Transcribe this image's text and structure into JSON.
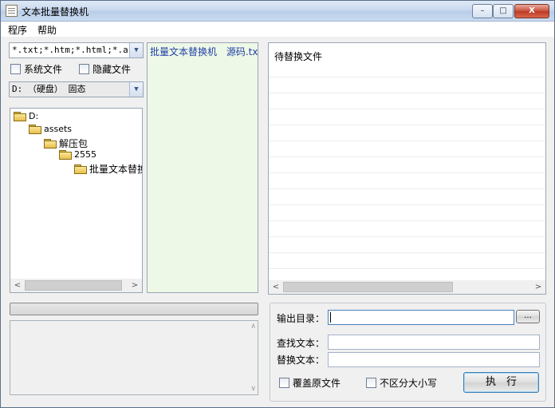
{
  "window": {
    "title": "文本批量替换机"
  },
  "titlebar": {
    "min": "–",
    "max": "□",
    "close": "X"
  },
  "menu": [
    {
      "label": "程序"
    },
    {
      "label": "帮助"
    }
  ],
  "filter": {
    "value": "*.txt;*.htm;*.html;*.asp"
  },
  "options": {
    "system_files": "系统文件",
    "hidden_files": "隐藏文件"
  },
  "drive": {
    "value": "D: （硬盘） 固态"
  },
  "tree": [
    {
      "label": "D:",
      "level": 0
    },
    {
      "label": "assets",
      "level": 1
    },
    {
      "label": "解压包",
      "level": 2
    },
    {
      "label": "2555",
      "level": 3
    },
    {
      "label": "批量文本替换",
      "level": 4
    }
  ],
  "file_list": {
    "items": [
      "批量文本替换机",
      "源码.txt"
    ]
  },
  "preview": {
    "header": "待替换文件"
  },
  "output": {
    "dir_label": "输出目录：",
    "dir_value": "",
    "browse": "...",
    "find_label": "查找文本：",
    "find_value": "",
    "replace_label": "替换文本：",
    "replace_value": "",
    "overwrite": "覆盖原文件",
    "ignore_case": "不区分大小写",
    "execute": "执　行"
  },
  "colors": {
    "file_list_bg": "#eef8e6",
    "file_list_text": "#1f3fa8",
    "title_gradient": "#c7d8ee"
  }
}
